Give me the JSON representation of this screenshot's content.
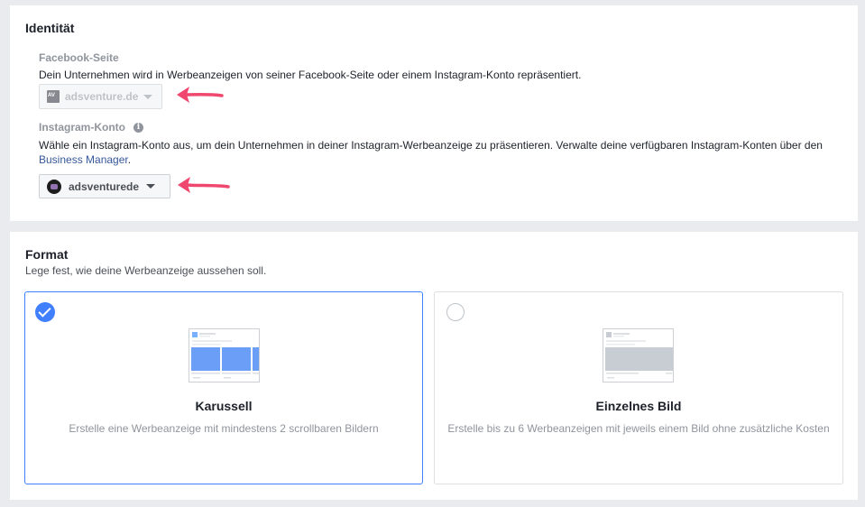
{
  "identity": {
    "title": "Identität",
    "facebook_label": "Facebook-Seite",
    "facebook_desc": "Dein Unternehmen wird in Werbeanzeigen von seiner Facebook-Seite oder einem Instagram-Konto repräsentiert.",
    "facebook_page": "adsventure.de",
    "instagram_label": "Instagram-Konto",
    "instagram_desc": "Wähle ein Instagram-Konto aus, um dein Unternehmen in deiner Instagram-Werbeanzeige zu präsentieren. Verwalte deine verfügbaren Instagram-Konten über den",
    "instagram_link": "Business Manager",
    "instagram_link_suffix": ".",
    "instagram_account": "adsventurede"
  },
  "format": {
    "title": "Format",
    "subtitle": "Lege fest, wie deine Werbeanzeige aussehen soll.",
    "options": [
      {
        "title": "Karussell",
        "desc": "Erstelle eine Werbeanzeige mit mindestens 2 scrollbaren Bildern",
        "selected": true
      },
      {
        "title": "Einzelnes Bild",
        "desc": "Erstelle bis zu 6 Werbeanzeigen mit jeweils einem Bild ohne zusätzliche Kosten",
        "selected": false
      }
    ]
  },
  "colors": {
    "accent": "#4080ff",
    "link": "#365899",
    "annotation_arrow": "#f0476f"
  }
}
